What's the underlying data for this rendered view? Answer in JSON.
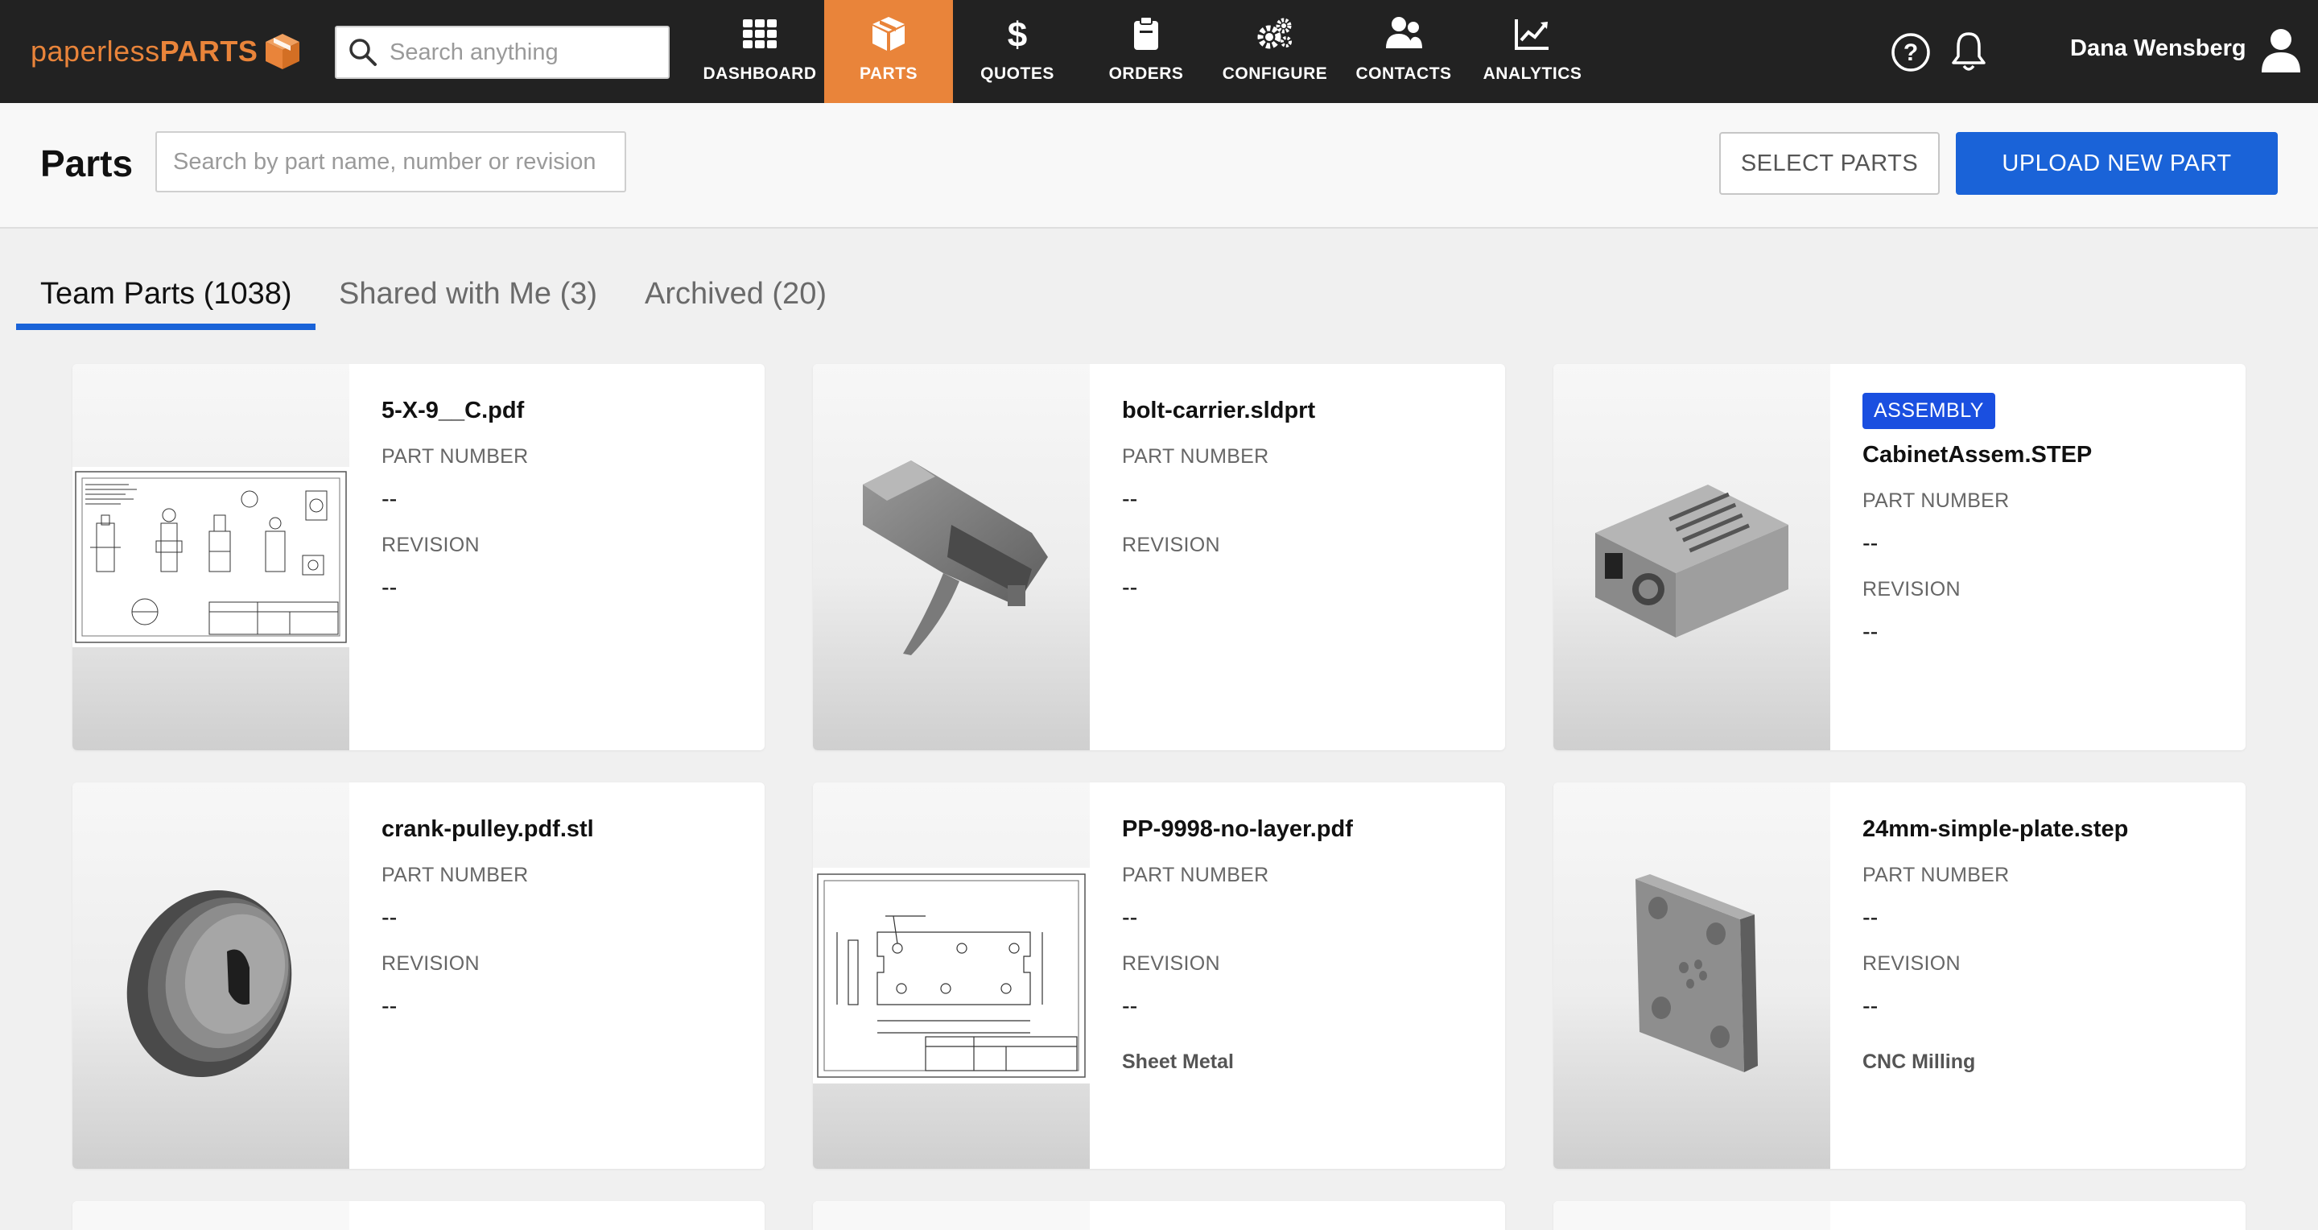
{
  "brand": {
    "thin": "paperless",
    "bold": "PARTS",
    "color": "#e9843a"
  },
  "top_search": {
    "placeholder": "Search anything"
  },
  "nav": [
    {
      "label": "DASHBOARD",
      "icon": "grid-icon"
    },
    {
      "label": "PARTS",
      "icon": "cube-icon",
      "active": true
    },
    {
      "label": "QUOTES",
      "icon": "dollar-icon"
    },
    {
      "label": "ORDERS",
      "icon": "clipboard-icon"
    },
    {
      "label": "CONFIGURE",
      "icon": "gears-icon"
    },
    {
      "label": "CONTACTS",
      "icon": "contacts-icon"
    },
    {
      "label": "ANALYTICS",
      "icon": "chart-icon"
    }
  ],
  "user": {
    "name": "Dana Wensberg"
  },
  "header": {
    "title": "Parts",
    "search_placeholder": "Search by part name, number or revision",
    "select_label": "SELECT PARTS",
    "upload_label": "UPLOAD NEW PART"
  },
  "tabs": [
    {
      "label": "Team Parts (1038)",
      "active": true
    },
    {
      "label": "Shared with Me (3)"
    },
    {
      "label": "Archived (20)"
    }
  ],
  "labels": {
    "part_number": "PART NUMBER",
    "revision": "REVISION"
  },
  "parts": [
    {
      "name": "5-X-9__C.pdf",
      "part_number": "--",
      "revision": "--",
      "thumb": "drawing-thumb"
    },
    {
      "name": "bolt-carrier.sldprt",
      "part_number": "--",
      "revision": "--",
      "thumb": "bolt-carrier-thumb"
    },
    {
      "name": "CabinetAssem.STEP",
      "badge": "ASSEMBLY",
      "part_number": "--",
      "revision": "--",
      "thumb": "cabinet-thumb"
    },
    {
      "name": "crank-pulley.pdf.stl",
      "part_number": "--",
      "revision": "--",
      "thumb": "pulley-thumb"
    },
    {
      "name": "PP-9998-no-layer.pdf",
      "part_number": "--",
      "revision": "--",
      "process": "Sheet Metal",
      "thumb": "sheet-drawing-thumb"
    },
    {
      "name": "24mm-simple-plate.step",
      "part_number": "--",
      "revision": "--",
      "process": "CNC Milling",
      "thumb": "plate-thumb"
    }
  ],
  "colors": {
    "accent_blue": "#1a63d8",
    "badge_blue": "#1a4fe0",
    "nav_bg": "#222222",
    "active_nav": "#e9843a"
  }
}
